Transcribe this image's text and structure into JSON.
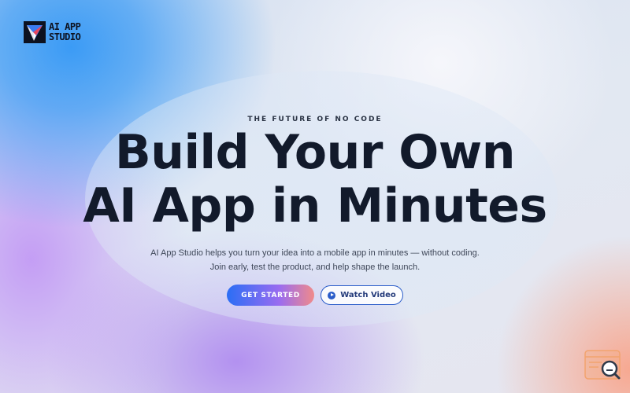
{
  "brand": {
    "logo_line1": "AI APP",
    "logo_line2": "STUDIO"
  },
  "hero": {
    "eyebrow": "THE FUTURE OF NO CODE",
    "headline_line1": "Build Your Own",
    "headline_line2": "AI App in Minutes",
    "subtext_line1": "AI App Studio helps you turn your idea into a mobile app in minutes — without coding.",
    "subtext_line2": "Join early, test the product, and help shape the launch."
  },
  "actions": {
    "primary_label": "GET STARTED",
    "secondary_label": "Watch Video"
  },
  "icons": {
    "logo": "paper-plane-logo-icon",
    "play": "play-circle-icon",
    "corner": "search-chat-icon"
  },
  "colors": {
    "headline": "#121a2b",
    "accent_blue": "#2a5cc9",
    "gradient_start": "#2b6ef5",
    "gradient_end": "#f08a8a"
  }
}
